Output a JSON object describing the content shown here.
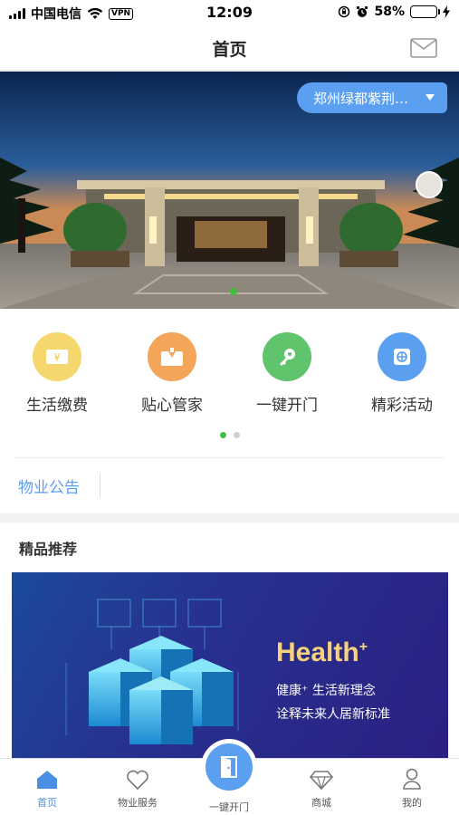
{
  "status_bar": {
    "carrier": "中国电信",
    "vpn": "VPN",
    "time": "12:09",
    "battery": "58%",
    "battery_level": 0.58
  },
  "nav": {
    "title": "首页",
    "mail_icon": "envelope-icon"
  },
  "banner": {
    "community": "郑州绿都紫荆…",
    "slide_index": 1,
    "slide_count": 1
  },
  "quick_actions": [
    {
      "label": "生活缴费",
      "icon": "yen-bill-icon",
      "color": "#f5d76e"
    },
    {
      "label": "贴心管家",
      "icon": "butler-icon",
      "color": "#f3a55a"
    },
    {
      "label": "一键开门",
      "icon": "key-icon",
      "color": "#5fc46b"
    },
    {
      "label": "精彩活动",
      "icon": "activity-icon",
      "color": "#5b9ff0"
    }
  ],
  "quick_actions_pages": {
    "current": 1,
    "total": 2
  },
  "notice": {
    "label": "物业公告"
  },
  "recommend": {
    "title": "精品推荐",
    "promo_title": "Health",
    "promo_title_sup": "+",
    "promo_line1": "健康⁺ 生活新理念",
    "promo_line2": "诠释未来人居新标准"
  },
  "tabbar": {
    "items": [
      {
        "label": "首页",
        "icon": "home-icon",
        "active": true
      },
      {
        "label": "物业服务",
        "icon": "heart-icon",
        "active": false
      },
      {
        "label": "一键开门",
        "icon": "door-icon",
        "active": false
      },
      {
        "label": "商城",
        "icon": "diamond-icon",
        "active": false
      },
      {
        "label": "我的",
        "icon": "user-icon",
        "active": false
      }
    ]
  },
  "colors": {
    "accent": "#5b9ff0",
    "active_dot": "#3fbf3f",
    "promo_title": "#f7d27a"
  }
}
